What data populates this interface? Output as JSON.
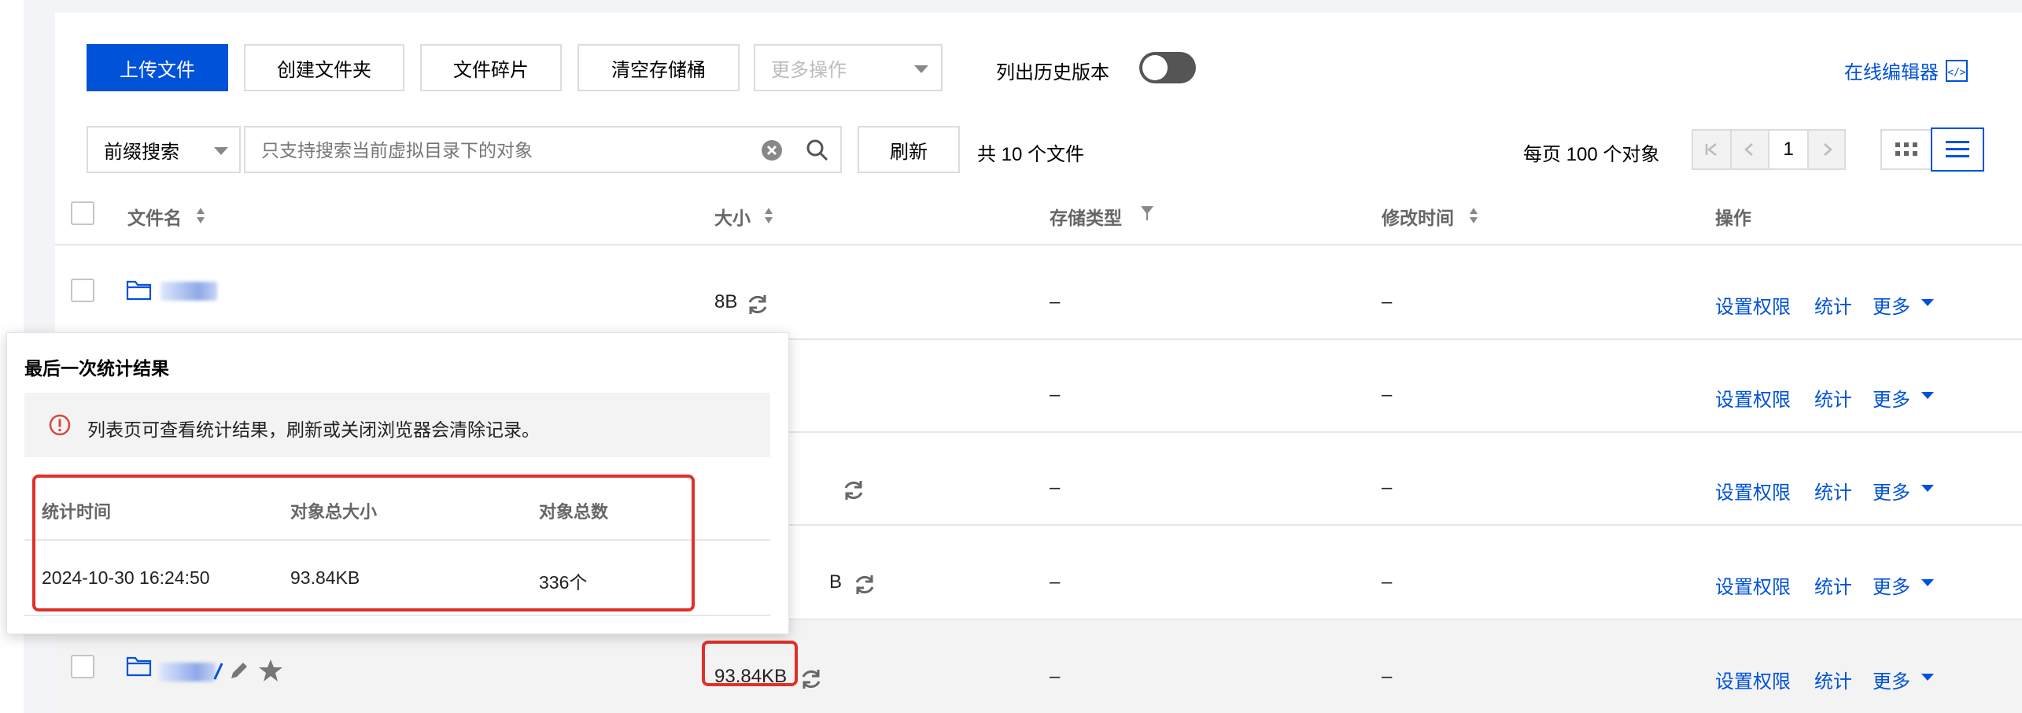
{
  "toolbar": {
    "upload": "上传文件",
    "create_folder": "创建文件夹",
    "fragments": "文件碎片",
    "clear_bucket": "清空存储桶",
    "more_actions": "更多操作",
    "history_label": "列出历史版本",
    "history_toggle_on": false,
    "online_editor": "在线编辑器"
  },
  "search": {
    "mode": "前缀搜索",
    "placeholder": "只支持搜索当前虚拟目录下的对象",
    "refresh": "刷新",
    "count_text": "共 10 个文件"
  },
  "pagination": {
    "per_page": "每页 100 个对象",
    "page": "1"
  },
  "table": {
    "columns": {
      "name": "文件名",
      "size": "大小",
      "storage": "存储类型",
      "modified": "修改时间",
      "actions": "操作"
    },
    "rows": [
      {
        "size": "8B",
        "storage": "–",
        "modified": "–"
      },
      {
        "size": "",
        "storage": "–",
        "modified": "–"
      },
      {
        "size": "",
        "storage": "–",
        "modified": "–"
      },
      {
        "size": "B",
        "storage": "–",
        "modified": "–"
      },
      {
        "size": "93.84KB",
        "storage": "–",
        "modified": "–"
      }
    ],
    "actions": {
      "permission": "设置权限",
      "stats": "统计",
      "more": "更多"
    }
  },
  "popover": {
    "title": "最后一次统计结果",
    "notice": "列表页可查看统计结果，刷新或关闭浏览器会清除记录。",
    "headers": {
      "time": "统计时间",
      "total_size": "对象总大小",
      "total_count": "对象总数"
    },
    "values": {
      "time": "2024-10-30 16:24:50",
      "total_size": "93.84KB",
      "total_count": "336个"
    }
  },
  "colors": {
    "primary": "#0052d9",
    "highlight": "#e0302a",
    "warning": "#d54941",
    "toggle_off": "#555555"
  }
}
